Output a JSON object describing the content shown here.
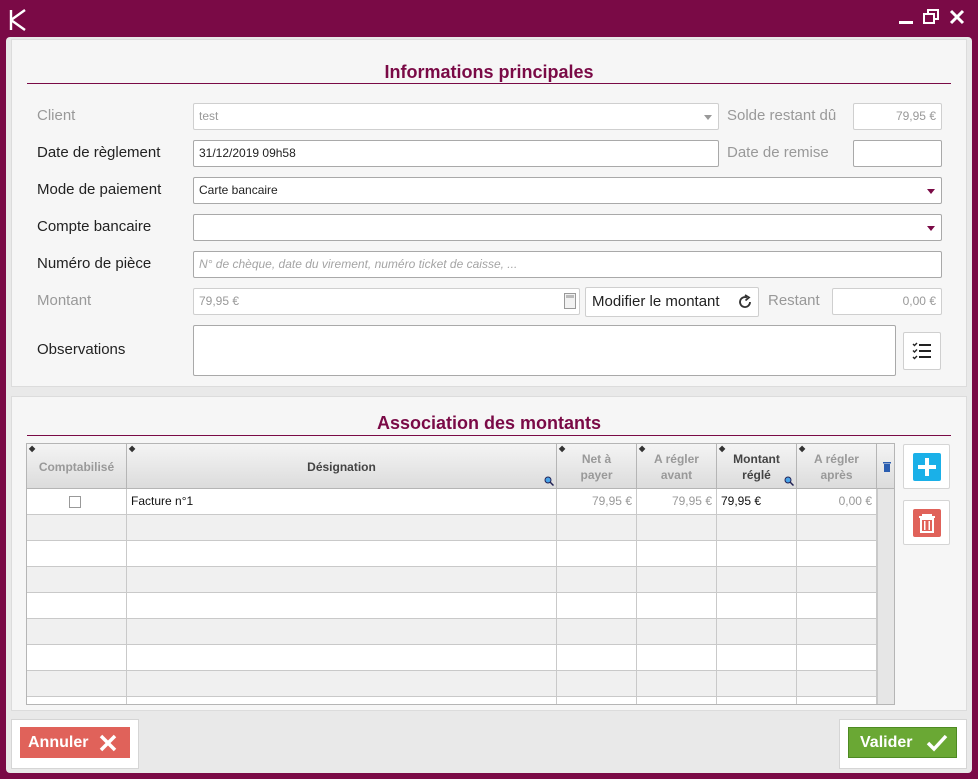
{
  "app": {
    "logo_letter": "K"
  },
  "window_controls": [
    "minimize-icon",
    "restore-icon",
    "close-icon"
  ],
  "colors": {
    "brand": "#7a0a46",
    "add": "#1ab0e8",
    "delete": "#e0625a",
    "validate": "#6aa834"
  },
  "main_info": {
    "title": "Informations principales",
    "client": {
      "label": "Client",
      "value": "test"
    },
    "solde": {
      "label": "Solde restant dû",
      "value": "79,95 €"
    },
    "date_reglement": {
      "label": "Date de règlement",
      "value": "31/12/2019 09h58"
    },
    "date_remise": {
      "label": "Date de remise",
      "value": ""
    },
    "mode_paiement": {
      "label": "Mode de paiement",
      "value": "Carte bancaire"
    },
    "compte_bancaire": {
      "label": "Compte bancaire",
      "value": ""
    },
    "numero_piece": {
      "label": "Numéro de pièce",
      "placeholder": "N° de chèque, date du virement, numéro ticket de caisse, ..."
    },
    "montant": {
      "label": "Montant",
      "value": "79,95 €"
    },
    "modifier_montant": "Modifier le montant",
    "restant": {
      "label": "Restant",
      "value": "0,00 €"
    },
    "observations": {
      "label": "Observations",
      "value": ""
    }
  },
  "association": {
    "title": "Association des montants",
    "columns": [
      "Comptabilisé",
      "Désignation",
      "Net à payer",
      "A régler avant",
      "Montant réglé",
      "A régler après"
    ],
    "rows": [
      {
        "comptabilise": false,
        "designation": "Facture n°1",
        "net": "79,95 €",
        "avant": "79,95 €",
        "regle": "79,95 €",
        "apres": "0,00 €"
      }
    ]
  },
  "footer": {
    "cancel": "Annuler",
    "validate": "Valider"
  }
}
